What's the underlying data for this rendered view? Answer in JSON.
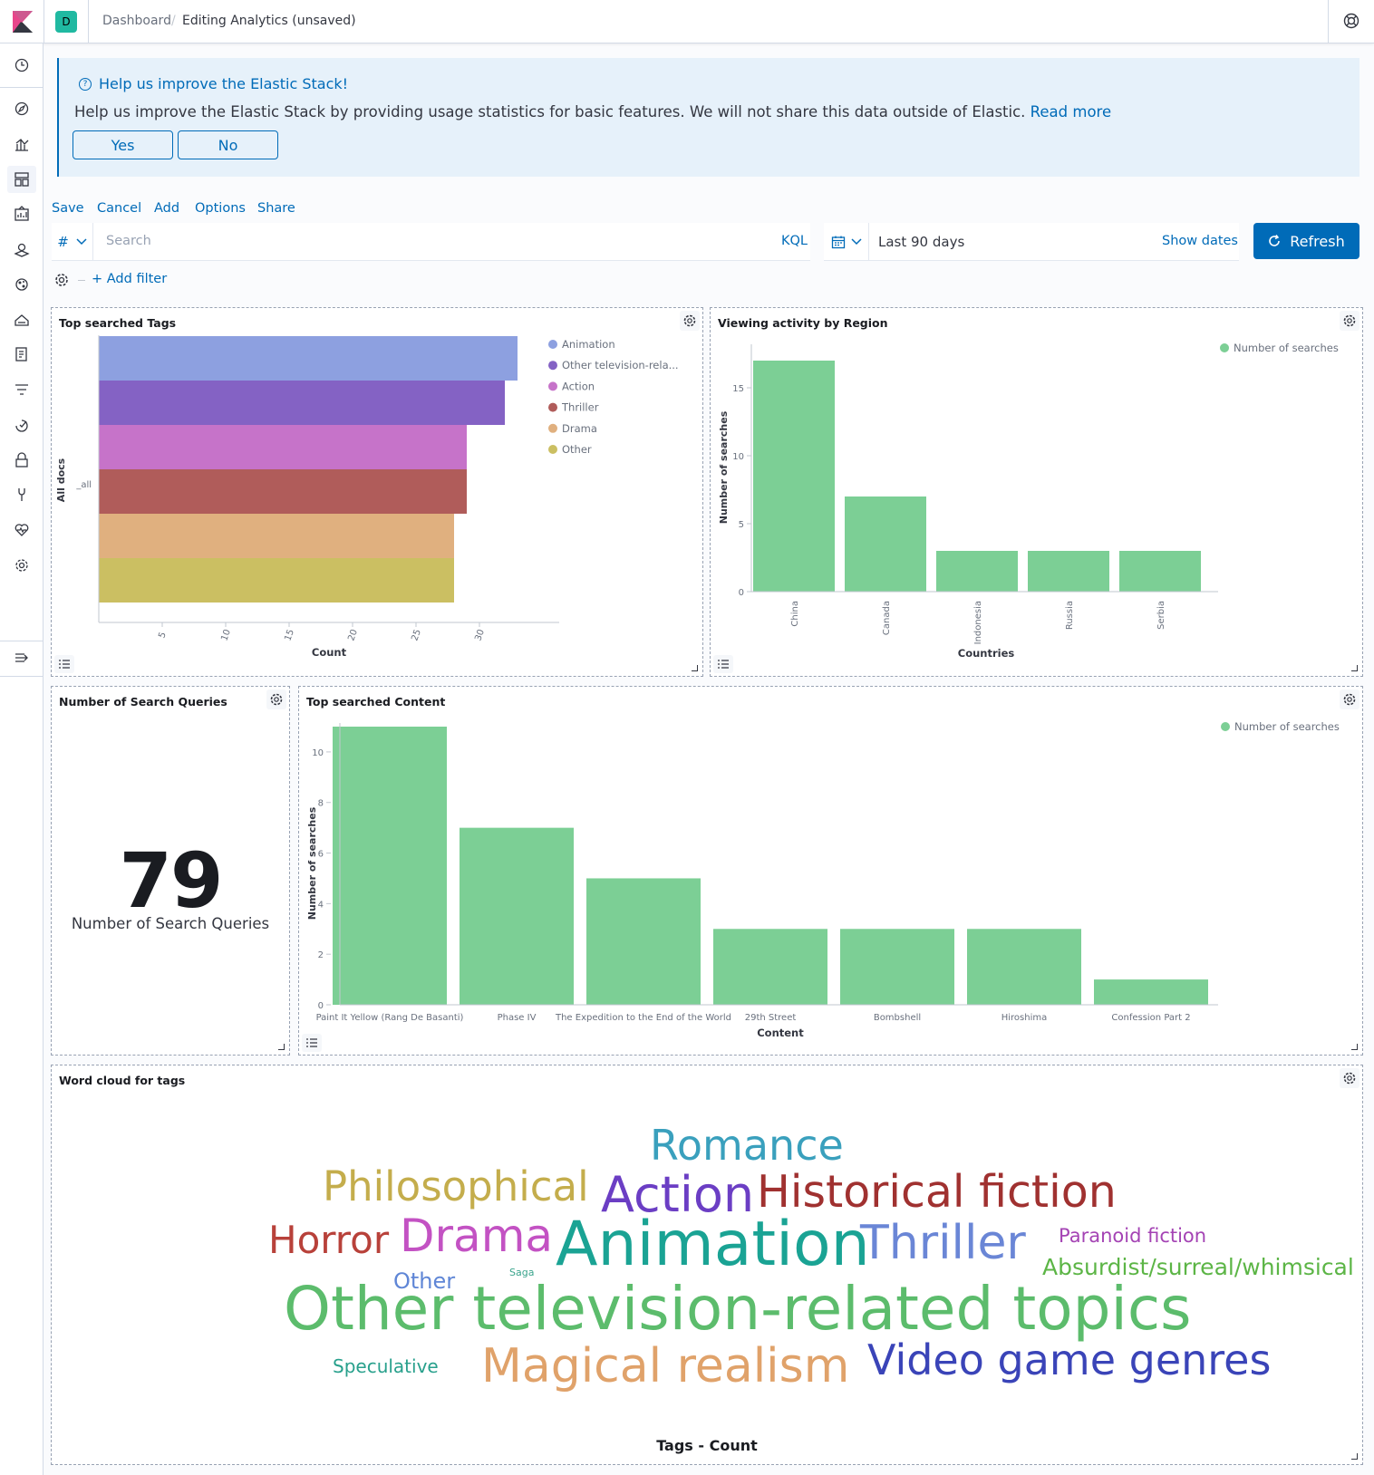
{
  "header": {
    "space_initial": "D",
    "breadcrumbs": [
      "Dashboard",
      "Editing Analytics (unsaved)"
    ],
    "breadcrumb_separator": "/"
  },
  "sidenav": {
    "icons": [
      "recent-icon",
      "discover-icon",
      "visualize-icon",
      "dashboard-icon",
      "canvas-icon",
      "maps-icon",
      "ml-icon",
      "infrastructure-icon",
      "logs-icon",
      "apm-icon",
      "uptime-icon",
      "siem-icon",
      "dev-tools-icon",
      "monitoring-icon",
      "management-icon",
      "collapse-icon"
    ]
  },
  "callout": {
    "title": "Help us improve the Elastic Stack!",
    "body": "Help us improve the Elastic Stack by providing usage statistics for basic features. We will not share this data outside of Elastic.",
    "link": "Read more",
    "yes": "Yes",
    "no": "No"
  },
  "menu": {
    "save": "Save",
    "cancel": "Cancel",
    "add": "Add",
    "options": "Options",
    "share": "Share"
  },
  "query": {
    "type_symbol": "#",
    "placeholder": "Search",
    "language": "KQL",
    "range": "Last 90 days",
    "show_dates": "Show dates",
    "refresh": "Refresh",
    "add_filter": "+ Add filter"
  },
  "panels": {
    "tags": {
      "title": "Top searched Tags",
      "ylabel": "All docs",
      "category": "_all",
      "xlabel": "Count",
      "legend": [
        "Animation",
        "Other television-rela...",
        "Action",
        "Thriller",
        "Drama",
        "Other"
      ]
    },
    "region": {
      "title": "Viewing activity by Region",
      "xlabel": "Countries",
      "ylabel": "Number of searches",
      "legend": "Number of searches"
    },
    "metric": {
      "title": "Number of Search Queries",
      "value": "79",
      "label": "Number of Search Queries"
    },
    "content": {
      "title": "Top searched Content",
      "xlabel": "Content",
      "ylabel": "Number of searches",
      "legend": "Number of searches"
    },
    "wordcloud": {
      "title": "Word cloud for tags",
      "axis_label": "Tags - Count",
      "words": [
        "Romance",
        "Philosophical",
        "Action",
        "Historical fiction",
        "Horror",
        "Drama",
        "Animation",
        "Thriller",
        "Paranoid fiction",
        "Absurdist/surreal/whimsical",
        "Other",
        "Saga",
        "Other television-related topics",
        "Speculative",
        "Magical realism",
        "Video game genres"
      ]
    }
  },
  "colors": {
    "accent": "#006bb8",
    "bar_green": "#7ccf95",
    "animation": "#8da0e0",
    "other_tv": "#8462c4",
    "action": "#c673c9",
    "thriller": "#b05c5a",
    "drama": "#e0b07f",
    "other": "#cbbf62"
  },
  "chart_data": [
    {
      "type": "bar",
      "orientation": "horizontal",
      "stacked": true,
      "title": "Top searched Tags",
      "categories": [
        "_all"
      ],
      "xlabel": "Count",
      "ylabel": "All docs",
      "x_ticks": [
        5,
        10,
        15,
        20,
        25,
        30
      ],
      "series": [
        {
          "name": "Animation",
          "values": [
            33
          ]
        },
        {
          "name": "Other television-rela...",
          "values": [
            32
          ]
        },
        {
          "name": "Action",
          "values": [
            29
          ]
        },
        {
          "name": "Thriller",
          "values": [
            29
          ]
        },
        {
          "name": "Drama",
          "values": [
            28
          ]
        },
        {
          "name": "Other",
          "values": [
            28
          ]
        }
      ],
      "legend": "top-right"
    },
    {
      "type": "bar",
      "title": "Viewing activity by Region",
      "categories": [
        "China",
        "Canada",
        "Indonesia",
        "Russia",
        "Serbia"
      ],
      "series": [
        {
          "name": "Number of searches",
          "values": [
            17,
            7,
            3,
            3,
            3
          ]
        }
      ],
      "xlabel": "Countries",
      "ylabel": "Number of searches",
      "ylim": [
        0,
        18
      ],
      "y_ticks": [
        0,
        5,
        10,
        15
      ],
      "legend": "top-right"
    },
    {
      "type": "bar",
      "title": "Top searched Content",
      "categories": [
        "Paint It Yellow (Rang De Basanti)",
        "Phase IV",
        "The Expedition to the End of the World",
        "29th Street",
        "Bombshell",
        "Hiroshima",
        "Confession Part 2"
      ],
      "series": [
        {
          "name": "Number of searches",
          "values": [
            11,
            7,
            5,
            3,
            3,
            3,
            1
          ]
        }
      ],
      "xlabel": "Content",
      "ylabel": "Number of searches",
      "ylim": [
        0,
        11
      ],
      "y_ticks": [
        0,
        2,
        4,
        6,
        8,
        10
      ],
      "legend": "top-right"
    }
  ]
}
